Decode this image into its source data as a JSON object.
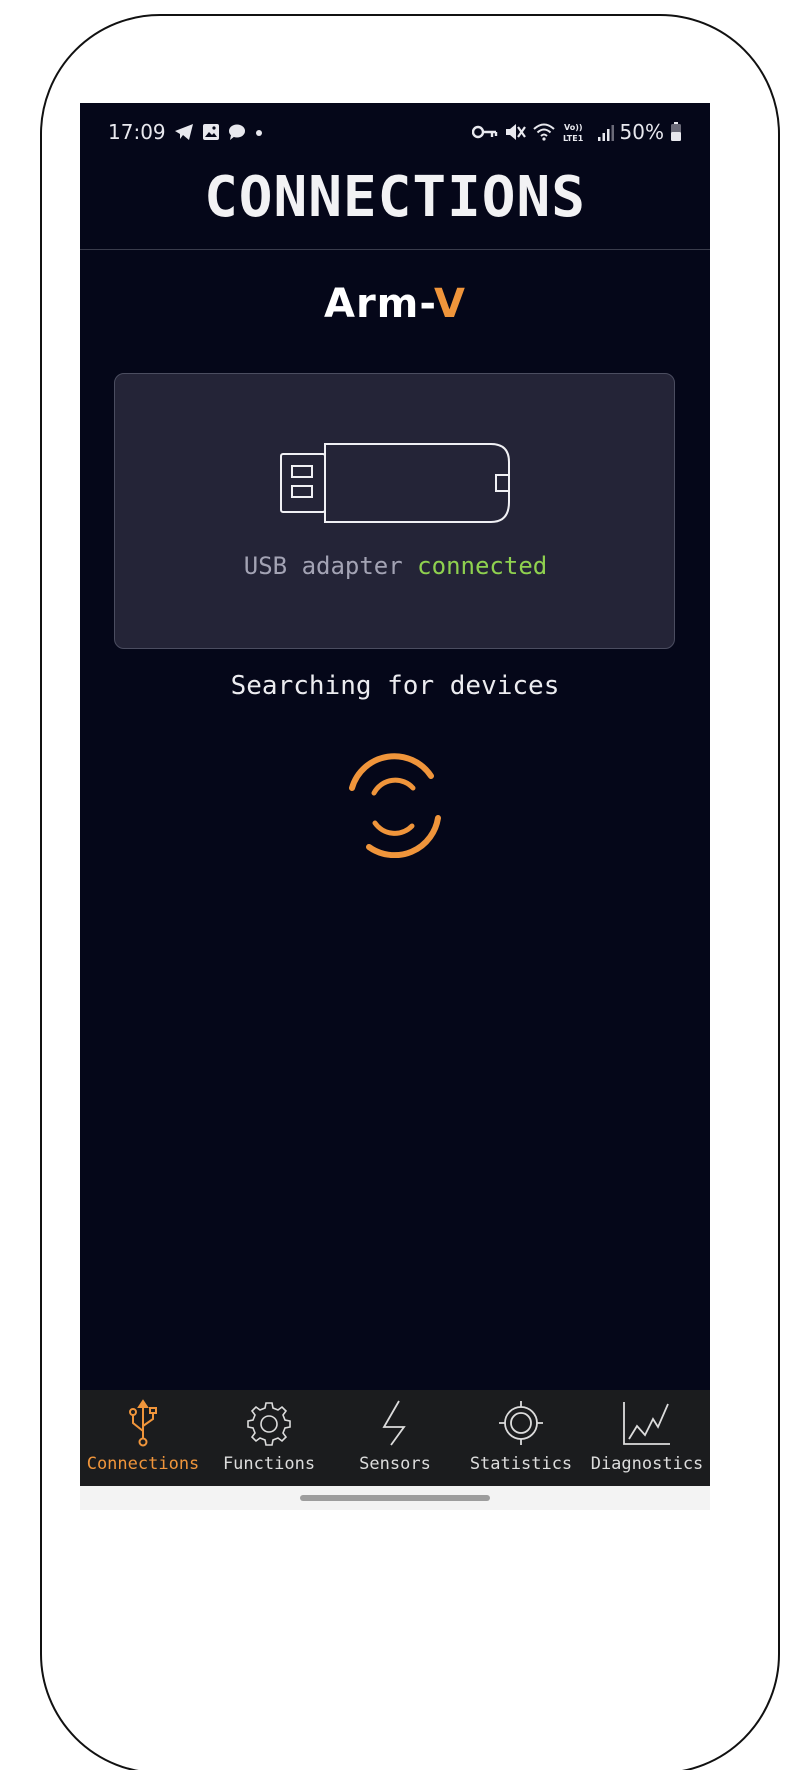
{
  "status_bar": {
    "time": "17:09",
    "battery": "50%",
    "left_icons": [
      "telegram-icon",
      "gallery-icon",
      "chat-icon",
      "dot-icon"
    ],
    "right_icons": [
      "key-icon",
      "mute-icon",
      "wifi-icon",
      "volte-lte-icon",
      "signal-icon",
      "battery-icon"
    ],
    "volte_label": "Vo)) LTE1"
  },
  "header": {
    "title": "CONNECTIONS"
  },
  "brand": {
    "name_main": "Arm-",
    "name_accent": "V"
  },
  "usb_card": {
    "icon": "usb-stick-icon",
    "status_prefix": "USB adapter",
    "status_value": "connected"
  },
  "search": {
    "text": "Searching for devices"
  },
  "nav": {
    "items": [
      {
        "label": "Connections",
        "icon": "usb-symbol-icon",
        "active": true
      },
      {
        "label": "Functions",
        "icon": "gear-icon",
        "active": false
      },
      {
        "label": "Sensors",
        "icon": "lightning-icon",
        "active": false
      },
      {
        "label": "Statistics",
        "icon": "target-icon",
        "active": false
      },
      {
        "label": "Diagnostics",
        "icon": "line-chart-icon",
        "active": false
      }
    ]
  },
  "colors": {
    "background": "#050719",
    "accent": "#f0953b",
    "success": "#8fd14f",
    "card": "#242437",
    "nav_bar": "#1b1c1e"
  }
}
